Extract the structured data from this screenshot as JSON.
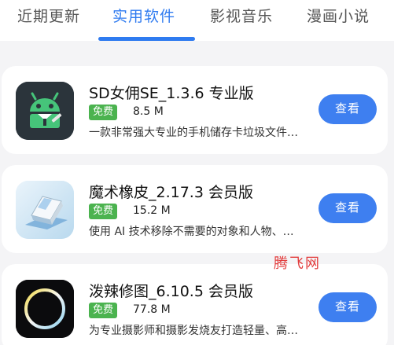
{
  "tabs": [
    {
      "label": "近期更新",
      "active": false
    },
    {
      "label": "实用软件",
      "active": true
    },
    {
      "label": "影视音乐",
      "active": false
    },
    {
      "label": "漫画小说",
      "active": false
    }
  ],
  "apps": [
    {
      "name": "SD女佣SE_1.3.6 专业版",
      "badge": "免费",
      "size": "8.5 M",
      "description": "一款非常强大专业的手机储存卡垃圾文件…",
      "button": "查看",
      "icon": "android-maid-icon"
    },
    {
      "name": "魔术橡皮_2.17.3 会员版",
      "badge": "免费",
      "size": "15.2 M",
      "description": "使用 AI 技术移除不需要的对象和人物、…",
      "button": "查看",
      "icon": "eraser-icon"
    },
    {
      "name": "泼辣修图_6.10.5 会员版",
      "badge": "免费",
      "size": "77.8 M",
      "description": "为专业摄影师和摄影发烧友打造轻量、高…",
      "button": "查看",
      "icon": "ring-lens-icon"
    }
  ],
  "watermark": "腾飞网",
  "colors": {
    "accent": "#2f7bf0",
    "button": "#3e7ff0",
    "badge": "#4bb34f",
    "watermark": "#e23a3a"
  }
}
